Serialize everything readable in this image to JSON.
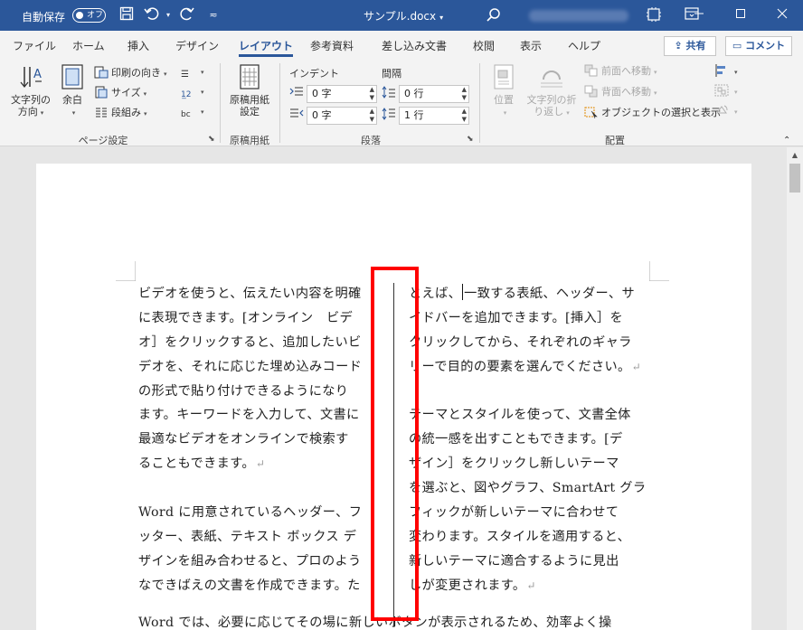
{
  "titlebar": {
    "autosave_label": "自動保存",
    "autosave_state": "オフ",
    "document_title": "サンプル.docx",
    "title_dropdown": "⌄"
  },
  "tabs": [
    {
      "label": "ファイル"
    },
    {
      "label": "ホーム"
    },
    {
      "label": "挿入"
    },
    {
      "label": "デザイン"
    },
    {
      "label": "レイアウト"
    },
    {
      "label": "参考資料"
    },
    {
      "label": "差し込み文書"
    },
    {
      "label": "校閲"
    },
    {
      "label": "表示"
    },
    {
      "label": "ヘルプ"
    }
  ],
  "share_label": "共有",
  "comment_label": "コメント",
  "ribbon": {
    "page_setup": {
      "text_direction_1": "文字列の",
      "text_direction_2": "方向",
      "margins": "余白",
      "orientation": "印刷の向き",
      "size": "サイズ",
      "columns": "段組み",
      "group": "ページ設定"
    },
    "genko": {
      "btn_1": "原稿用紙",
      "btn_2": "設定",
      "group": "原稿用紙"
    },
    "paragraph": {
      "indent_label": "インデント",
      "spacing_label": "間隔",
      "indent_left": "0 字",
      "indent_right": "0 字",
      "spacing_before": "0 行",
      "spacing_after": "1 行",
      "group": "段落"
    },
    "arrange": {
      "position": "位置",
      "wrap_1": "文字列の折",
      "wrap_2": "り返し",
      "bring_forward": "前面へ移動",
      "send_backward": "背面へ移動",
      "selection_pane": "オブジェクトの選択と表示",
      "group": "配置"
    }
  },
  "document": {
    "left_column": [
      "ビデオを使うと、伝えたい内容を明確",
      "に表現できます。[オンライン　ビデ",
      "オ］をクリックすると、追加したいビ",
      "デオを、それに応じた埋め込みコード",
      "の形式で貼り付けできるようになり",
      "ます。キーワードを入力して、文書に",
      "最適なビデオをオンラインで検索す",
      "ることもできます。",
      "",
      "Word に用意されているヘッダー、フ",
      "ッター、表紙、テキスト ボックス デ",
      "ザインを組み合わせると、プロのよう",
      "なできばえの文書を作成できます。た",
      "",
      "Word では、必要に応じてその場に新しいボタンが表示されるため、効率よく操"
    ],
    "right_column_first": "とえば、",
    "right_column_first_rest": "一致する表紙、ヘッダー、サ",
    "right_column": [
      "イドバーを追加できます。[挿入］を",
      "クリックしてから、それぞれのギャラ",
      "リーで目的の要素を選んでください。",
      "",
      "テーマとスタイルを使って、文書全体",
      "の統一感を出すこともできます。[デ",
      "ザイン］をクリックし新しいテーマ",
      "を選ぶと、図やグラフ、SmartArt グラ",
      "フィックが新しいテーマに合わせて",
      "変わります。スタイルを適用すると、",
      "新しいテーマに適合するように見出",
      "しが変更されます。"
    ],
    "para_mark": "↵"
  }
}
